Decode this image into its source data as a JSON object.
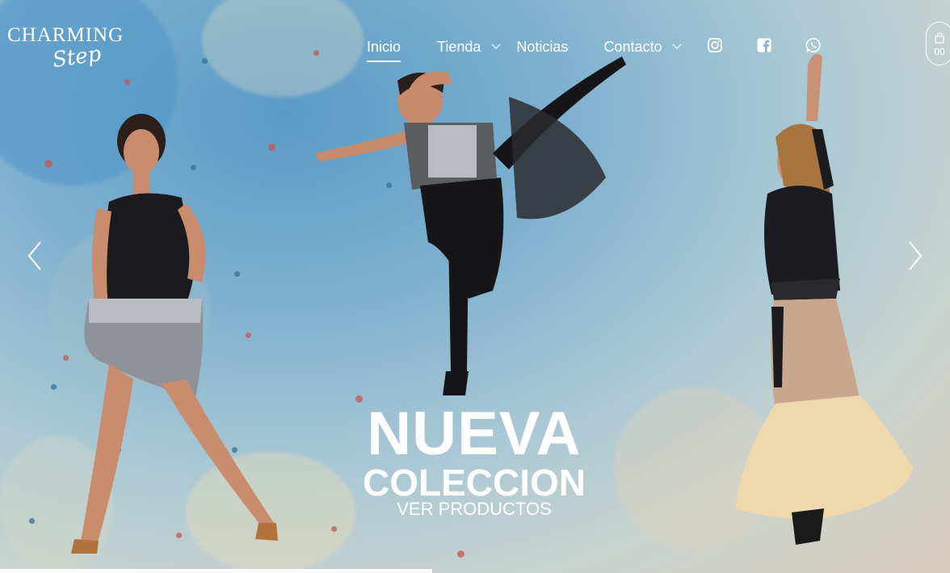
{
  "brand": {
    "line1": "CHARMING",
    "line2": "Step"
  },
  "nav": {
    "items": [
      {
        "label": "Inicio",
        "active": true
      },
      {
        "label": "Tienda",
        "has_dropdown": true
      },
      {
        "label": "Noticias"
      },
      {
        "label": "Contacto",
        "has_dropdown": true
      }
    ]
  },
  "social": {
    "icons": [
      "instagram-icon",
      "facebook-icon",
      "whatsapp-icon"
    ]
  },
  "cart": {
    "count": "00",
    "icon": "shopping-bag-icon"
  },
  "slider": {
    "headline": "NUEVA",
    "subheadline": "COLECCION",
    "cta": "VER PRODUCTOS",
    "progress": 0.455,
    "prev_icon": "chevron-left-icon",
    "next_icon": "chevron-right-icon"
  },
  "colors": {
    "accent": "#ffffff",
    "sky": "#7fb1cf",
    "warm": "#d8cdbd"
  }
}
